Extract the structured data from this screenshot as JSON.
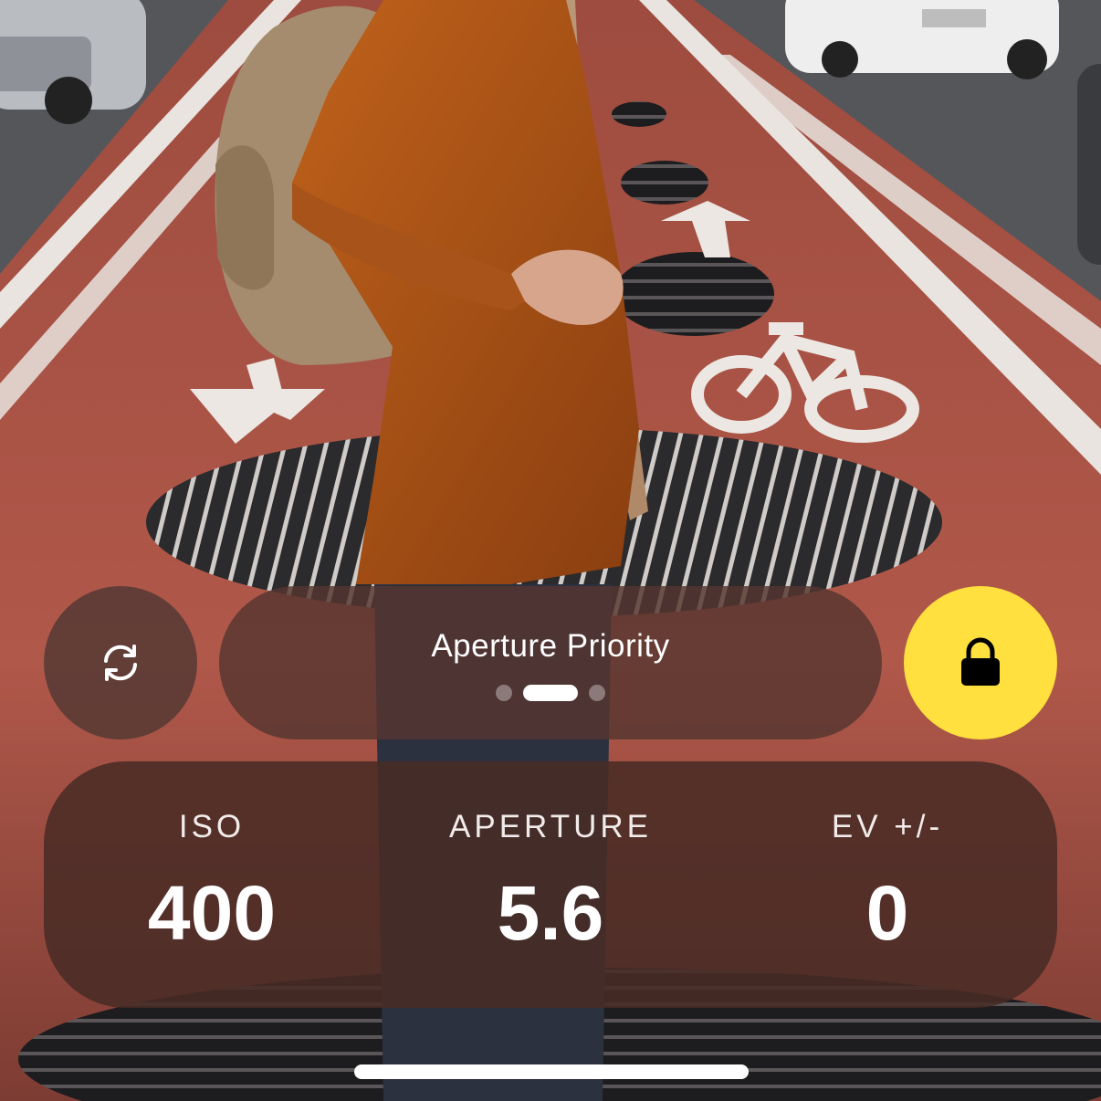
{
  "mode": {
    "label": "Aperture Priority",
    "pages": 3,
    "active_page": 1
  },
  "controls": {
    "switch_icon": "refresh-icon",
    "lock_icon": "lock-icon",
    "lock_color": "#ffe03e"
  },
  "settings": {
    "iso": {
      "label": "ISO",
      "value": "400"
    },
    "aperture": {
      "label": "APERTURE",
      "value": "5.6"
    },
    "ev": {
      "label": "EV +/-",
      "value": "0"
    }
  }
}
